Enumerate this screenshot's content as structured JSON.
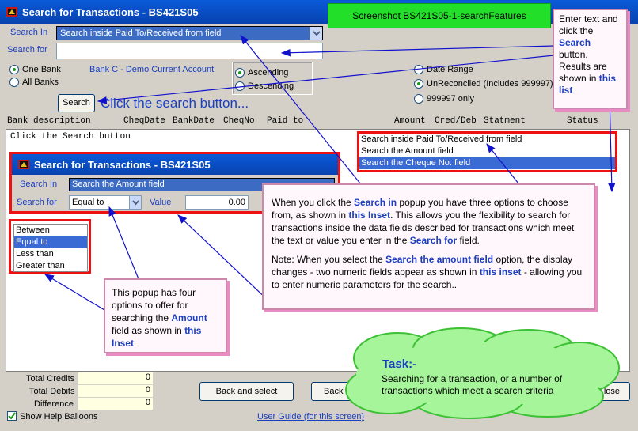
{
  "window": {
    "title": "Search for Transactions - BS421S05"
  },
  "screenshot_label": "Screenshot BS421S05-1-searchFeatures",
  "search_in": {
    "label": "Search In",
    "value": "Search inside Paid To/Received from field"
  },
  "search_for": {
    "label": "Search for",
    "value": ""
  },
  "bank": {
    "one_bank": "One Bank",
    "all_banks": "All Banks",
    "bank_name": "Bank C - Demo Current Account"
  },
  "sort": {
    "ascending": "Ascending",
    "descending": "Descending"
  },
  "filter": {
    "date_range": "Date Range",
    "unreconciled": "UnReconciled (Includes 999997)",
    "only_999997": "999997 only"
  },
  "search_button": "Search",
  "search_hint": "Click the search button...",
  "columns": {
    "bank_description": "Bank description",
    "cheq_date": "CheqDate",
    "bank_date": "BankDate",
    "cheq_no": "CheqNo",
    "paid_to": "Paid to",
    "amount": "Amount",
    "cred_deb": "Cred/Deb",
    "statement": "Statment",
    "status": "Status"
  },
  "empty_message": "Click the Search button",
  "search_in_options": [
    "Search inside Paid To/Received from field",
    "Search the Amount field",
    "Search the Cheque No. field"
  ],
  "inset": {
    "title": "Search for Transactions - BS421S05",
    "search_in_label": "Search In",
    "search_in_value": "Search the Amount field",
    "search_for_label": "Search for",
    "operator": "Equal to",
    "value_label": "Value",
    "value": "0.00"
  },
  "operator_options": [
    "Between",
    "Equal to",
    "Less than",
    "Greater than"
  ],
  "totals": {
    "credits_label": "Total Credits",
    "credits": "0",
    "debits_label": "Total Debits",
    "debits": "0",
    "difference_label": "Difference",
    "difference": "0"
  },
  "show_help": "Show Help Balloons",
  "buttons": {
    "back_select": "Back and select",
    "back": "Back",
    "close": "lose"
  },
  "user_guide": "User Guide (for this screen)",
  "notes": {
    "enter_text": {
      "p1": "Enter text and click the ",
      "search": "Search",
      "p2": " button. Results are shown in ",
      "this_list": "this list"
    },
    "main": {
      "a1": "When you click the ",
      "search_in": "Search in",
      "a2": " popup you have three options to choose from, as shown in ",
      "this_inset": "this Inset",
      "a3": ". This allows you the flexibility to search for transactions inside the data fields described for transactions which meet the text or value you enter in the ",
      "search_for": "Search for",
      "a4": " field.",
      "b1": "Note: When you select the ",
      "amount_field": "Search the amount field",
      "b2": " option, the display changes - two numeric fields appear as shown in ",
      "this_inset2": "this inset",
      "b3": " - allowing you to enter numeric parameters for the search.."
    },
    "popup": {
      "a1": "This popup has four options to offer for searching the ",
      "amount": "Amount",
      "a2": " field as shown in ",
      "this_inset": "this Inset"
    },
    "task": {
      "title": "Task:-",
      "text": "Searching for a transaction, or a number of transactions which meet a search criteria"
    }
  },
  "colors": {
    "title_bar": "#0a5ad8",
    "annotation_red": "#ee1111",
    "note_pink": "#e98cc4",
    "cloud_green": "#a6f59a",
    "label_blue": "#1a3fbf"
  }
}
